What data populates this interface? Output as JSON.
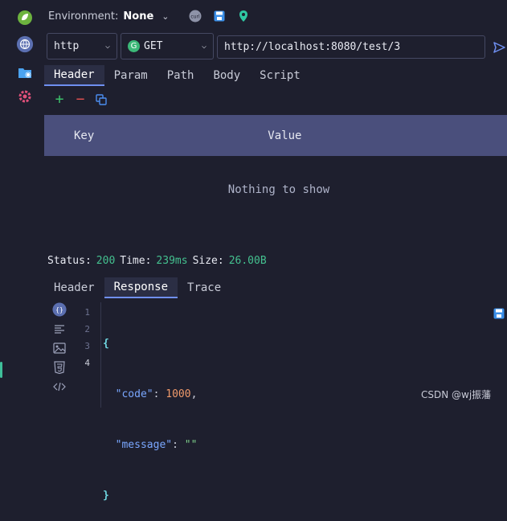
{
  "rail": {
    "icons": [
      "spring-leaf-icon",
      "http-globe-icon",
      "folder-globe-icon",
      "settings-gear-icon"
    ]
  },
  "env": {
    "label": "Environment:",
    "value": "None"
  },
  "top_icons": [
    "curl-icon",
    "save-icon",
    "location-pin-icon"
  ],
  "curl_badge": "curl",
  "request": {
    "protocol": "http",
    "method_badge": "G",
    "method": "GET",
    "url": "http://localhost:8080/test/3"
  },
  "request_tabs": [
    "Header",
    "Param",
    "Path",
    "Body",
    "Script"
  ],
  "active_request_tab": "Header",
  "header_table": {
    "columns": [
      "Key",
      "Value"
    ],
    "empty_text": "Nothing to show"
  },
  "status": {
    "status_label": "Status:",
    "status_value": "200",
    "time_label": "Time:",
    "time_value": "239ms",
    "size_label": "Size:",
    "size_value": "26.00B"
  },
  "response_tabs": [
    "Header",
    "Response",
    "Trace"
  ],
  "active_response_tab": "Response",
  "response_body": {
    "line_numbers": [
      "1",
      "2",
      "3",
      "4"
    ],
    "lines": [
      {
        "open": "{"
      },
      {
        "key": "\"code\"",
        "sep": ": ",
        "value": "1000",
        "tail": ","
      },
      {
        "key": "\"message\"",
        "sep": ": ",
        "value": "\"\""
      },
      {
        "close": "}"
      }
    ]
  },
  "watermark": "CSDN @wj振藩",
  "colors": {
    "background": "#1e1f2e",
    "table_header": "#4a4f7c",
    "status_value": "#44c08f",
    "accent": "#6f8ff0"
  }
}
